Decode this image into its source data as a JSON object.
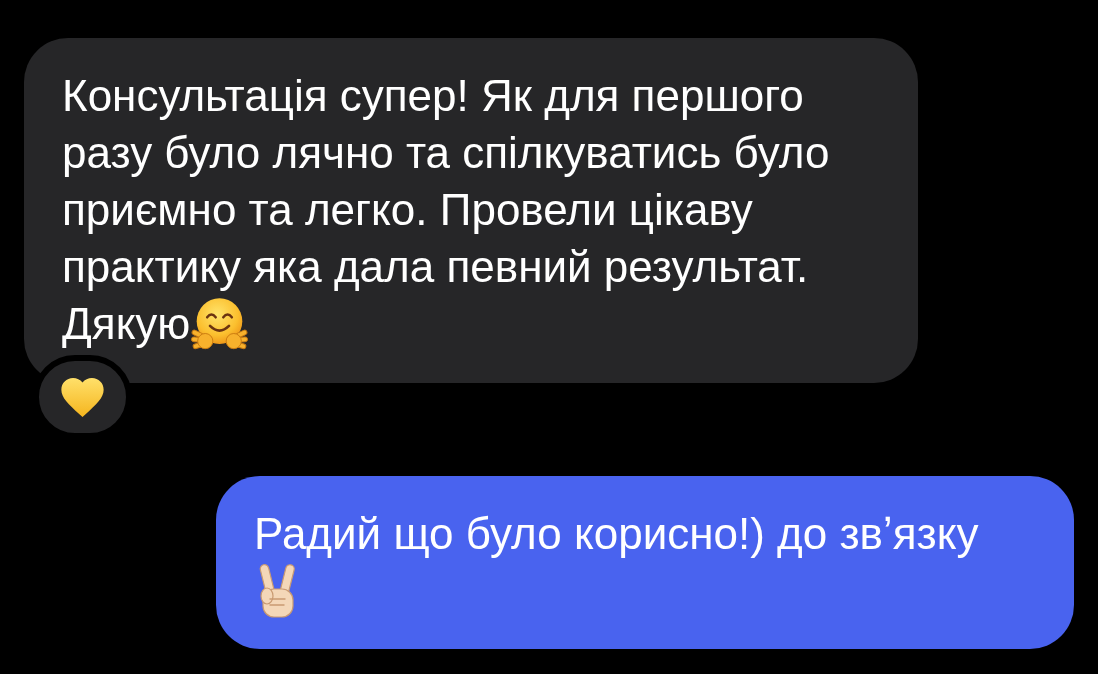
{
  "messages": [
    {
      "kind": "incoming",
      "paragraphs": [
        "Консультація супер! Як для першого разу було лячно та спілкуватись було приємно та легко. Провели цікаву практику яка дала певний результат.",
        "Дякую"
      ]
    },
    {
      "kind": "outgoing",
      "paragraphs": [
        "Радий що було корисно!) до звʼязку"
      ]
    }
  ]
}
